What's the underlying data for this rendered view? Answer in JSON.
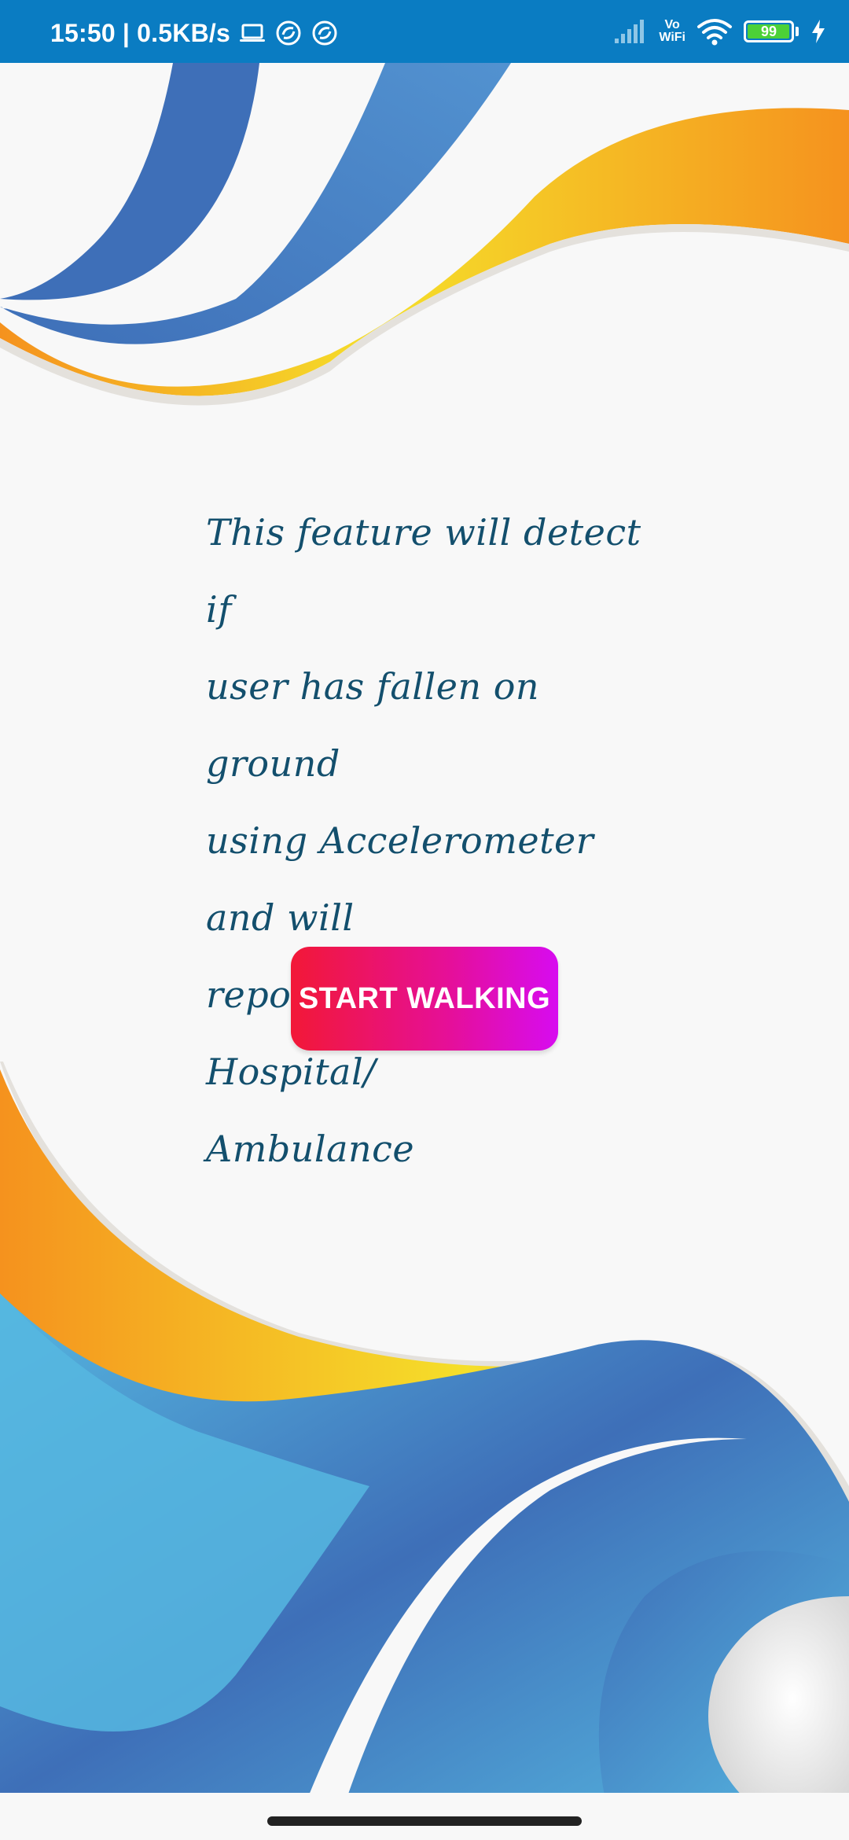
{
  "status_bar": {
    "time_speed": "15:50 | 0.5KB/s",
    "signal_label_line1": "Vo",
    "signal_label_line2": "WiFi",
    "battery_level": "99",
    "battery_percent": 99,
    "color": "#0a7cc2"
  },
  "main": {
    "description": "This feature will detect if\nuser has fallen on ground\nusing Accelerometer and will\nreport nearest Hospital/\nAmbulance",
    "start_button_label": "START WALKING"
  },
  "colors": {
    "description_text": "#134f6d",
    "button_gradient_start": "#f21837",
    "button_gradient_end": "#d70cf0",
    "wave_blue": "#3e6fb8",
    "wave_light_blue": "#56b7e0",
    "wave_orange": "#f5921e",
    "wave_yellow": "#f5df2a"
  },
  "icons": {
    "laptop": "laptop-icon",
    "sync_a": "sync-icon",
    "sync_b": "sync-icon",
    "signal": "signal-strength-icon",
    "wifi": "wifi-icon",
    "battery": "battery-icon",
    "charging": "charging-bolt-icon"
  }
}
